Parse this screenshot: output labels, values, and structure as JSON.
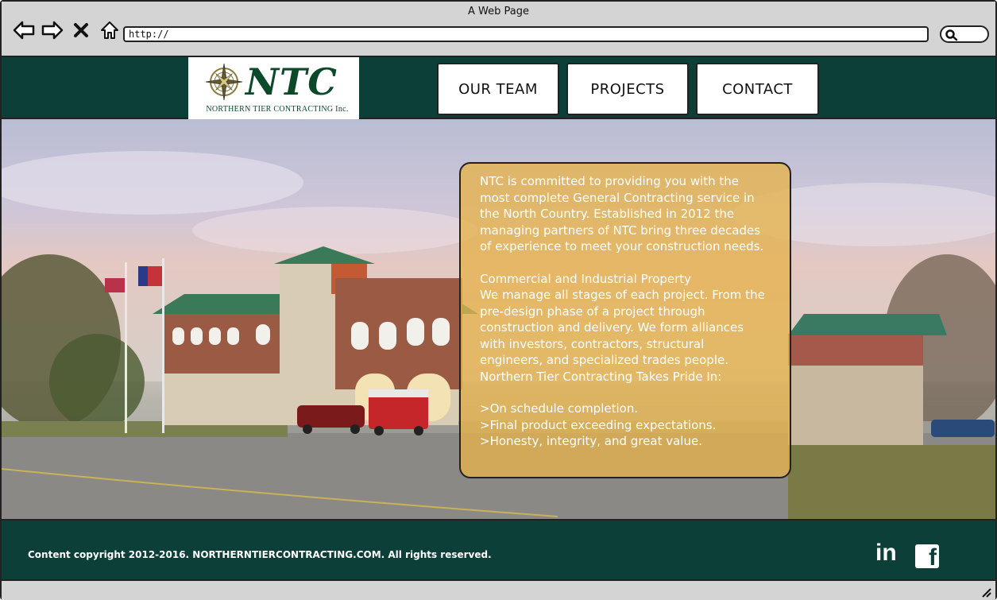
{
  "browser": {
    "window_title": "A Web Page",
    "url": "http://",
    "icons": [
      "back-arrow-icon",
      "forward-arrow-icon",
      "close-x-icon",
      "home-icon",
      "search-icon"
    ]
  },
  "header": {
    "logo_text": "NTC",
    "logo_subtitle": "NORTHERN TIER CONTRACTING  Inc.",
    "logo_icon": "compass-rose-icon",
    "nav": [
      {
        "label": "OUR TEAM"
      },
      {
        "label": "PROJECTS"
      },
      {
        "label": "CONTACT"
      }
    ],
    "background_color": "#0c3f38"
  },
  "hero": {
    "image": "fire-station-photo",
    "card_color": "#e6b24c",
    "paragraphs": {
      "intro": "NTC is committed to providing you with the most complete General Contracting service in the North Country. Established in 2012 the managing partners of NTC bring three decades of experience to meet your construction needs.",
      "section_title": "Commercial and Industrial Property",
      "section_body": "We manage all stages of each project. From the pre-design phase of a project through construction and delivery. We form alliances with investors, contractors, structural engineers, and specialized trades people.",
      "pride_title": "Northern Tier Contracting Takes Pride In:",
      "pride_items": [
        ">On schedule completion.",
        ">Final product exceeding expectations.",
        ">Honesty, integrity, and great value."
      ]
    }
  },
  "footer": {
    "copyright": "Content copyright 2012-2016. NORTHERNTIERCONTRACTING.COM. All rights reserved.",
    "social": [
      "linkedin-icon",
      "facebook-icon"
    ],
    "linkedin_label": "in",
    "facebook_label": "f"
  }
}
